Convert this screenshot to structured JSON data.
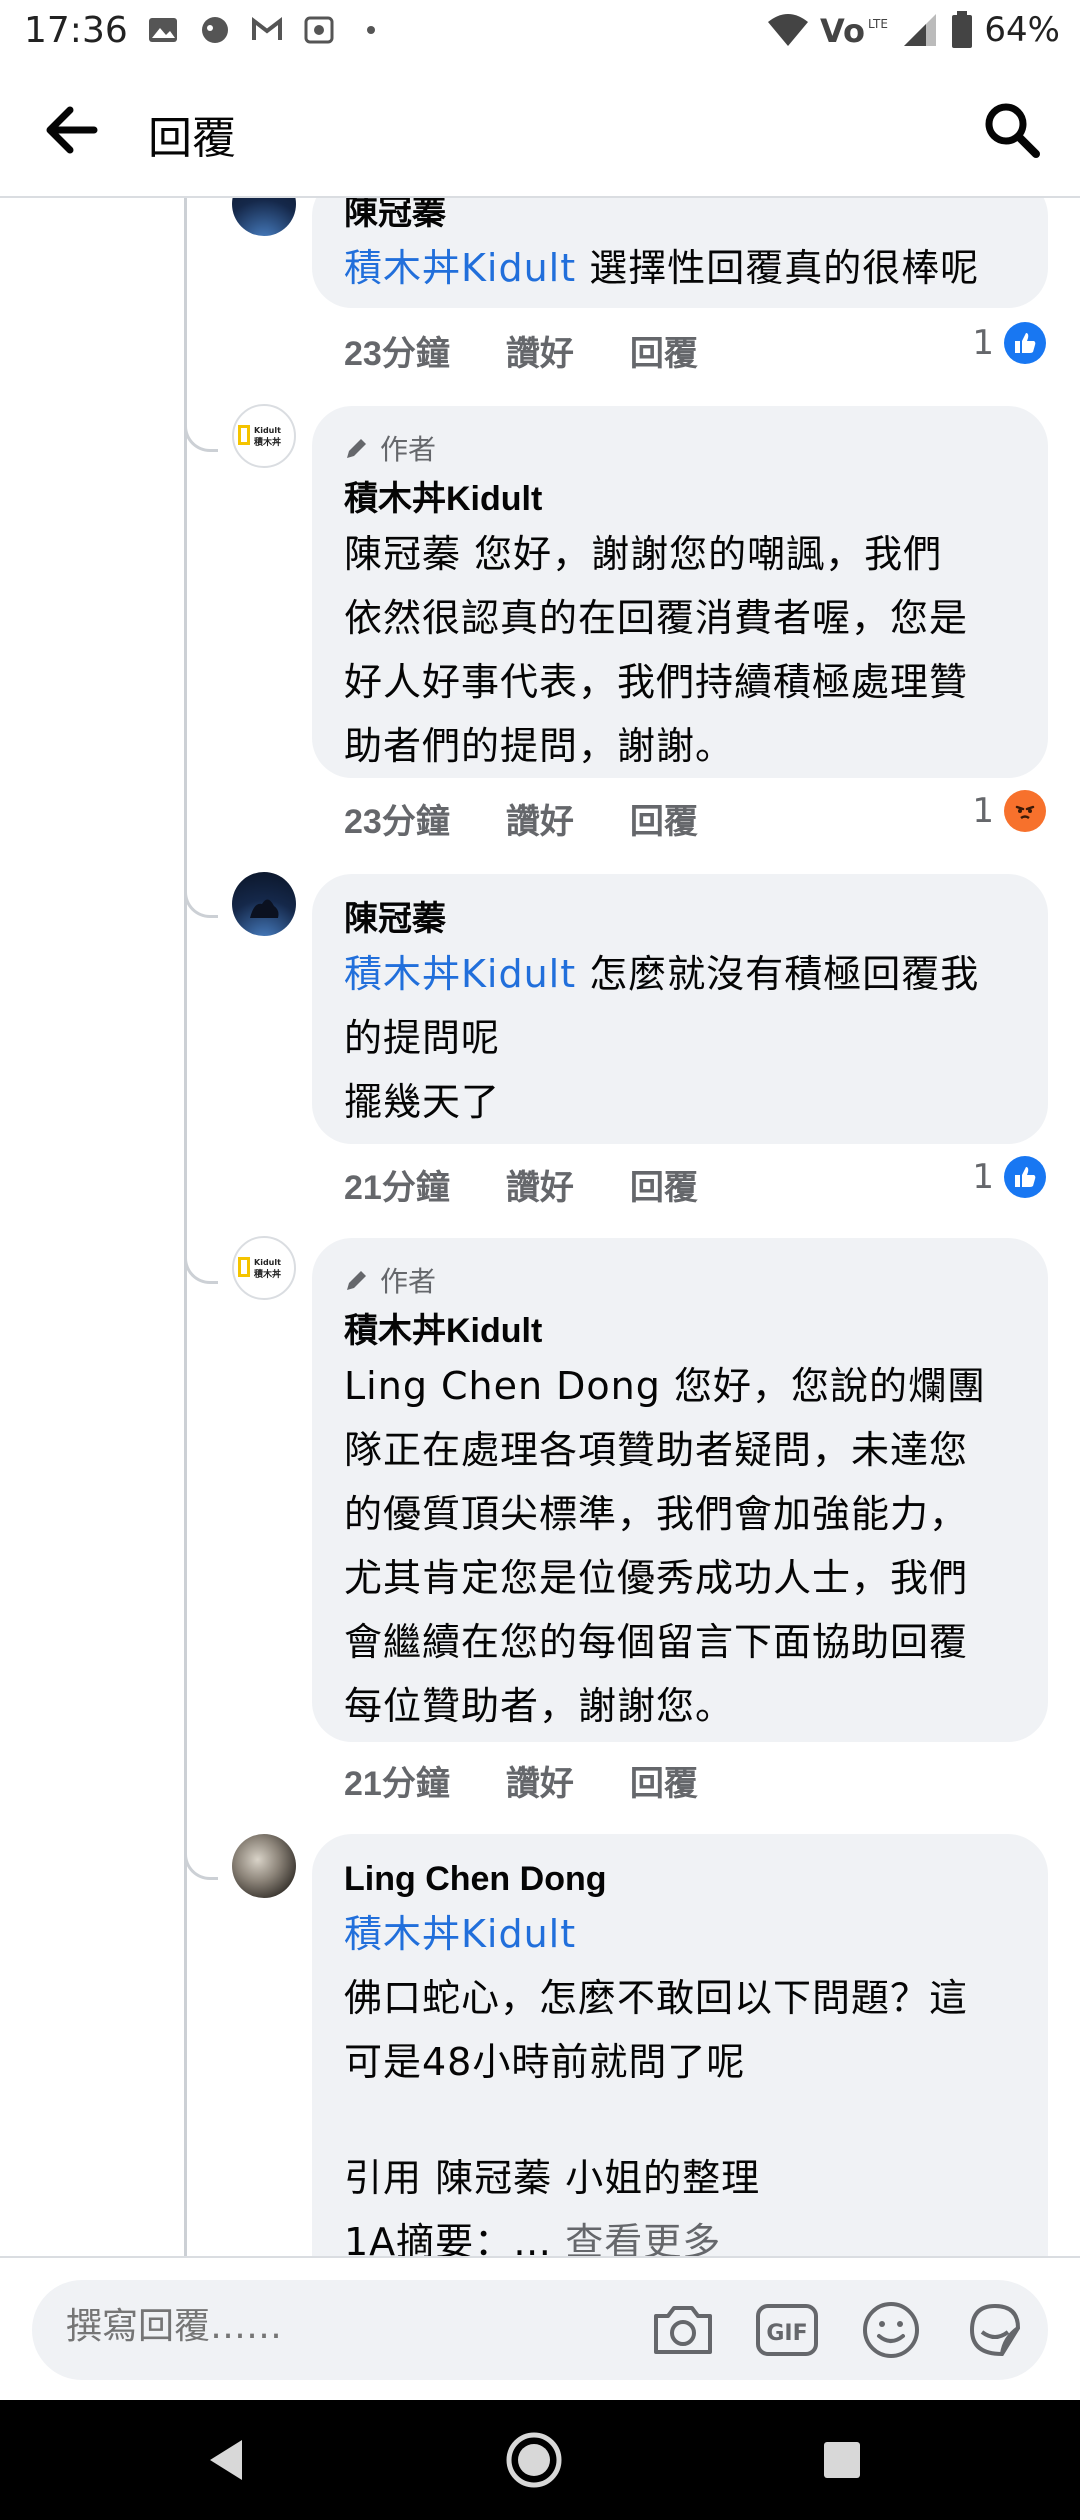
{
  "status_bar": {
    "time": "17:36",
    "battery": "64%",
    "icons_left": [
      "gallery-icon",
      "messenger-bot-icon",
      "gmail-icon",
      "photo-app-icon",
      "dot-icon"
    ],
    "icons_right": [
      "wifi-icon",
      "volte-icon",
      "signal-icon",
      "battery-icon"
    ]
  },
  "header": {
    "title": "回覆",
    "back_icon": "back-arrow-icon",
    "search_icon": "search-icon"
  },
  "comments": [
    {
      "author": "陳冠蓁",
      "mention": "積木丼Kidult",
      "lines": [
        " 選擇性回覆真的很棒呢"
      ],
      "time": "23分鐘",
      "like_label": "讚好",
      "reply_label": "回覆",
      "reaction": {
        "type": "like",
        "count": "1"
      }
    },
    {
      "author_badge": "作者",
      "author": "積木丼Kidult",
      "lines": [
        "陳冠蓁 您好，謝謝您的嘲諷，我們",
        "依然很認真的在回覆消費者喔，您是",
        "好人好事代表，我們持續積極處理贊",
        "助者們的提問，謝謝。"
      ],
      "time": "23分鐘",
      "like_label": "讚好",
      "reply_label": "回覆",
      "reaction": {
        "type": "angry",
        "count": "1"
      }
    },
    {
      "author": "陳冠蓁",
      "mention": "積木丼Kidult",
      "lines": [
        " 怎麼就沒有積極回覆我",
        "的提問呢",
        "擺幾天了"
      ],
      "time": "21分鐘",
      "like_label": "讚好",
      "reply_label": "回覆",
      "reaction": {
        "type": "like",
        "count": "1"
      }
    },
    {
      "author_badge": "作者",
      "author": "積木丼Kidult",
      "lines": [
        "Ling Chen Dong 您好，您說的爛團",
        "隊正在處理各項贊助者疑問，未達您",
        "的優質頂尖標準，我們會加強能力，",
        "尤其肯定您是位優秀成功人士，我們",
        "會繼續在您的每個留言下面協助回覆",
        "每位贊助者，謝謝您。"
      ],
      "time": "21分鐘",
      "like_label": "讚好",
      "reply_label": "回覆"
    },
    {
      "author": "Ling Chen Dong",
      "mention": "積木丼Kidult",
      "lines": [
        "佛口蛇心，怎麼不敢回以下問題？這",
        "可是48小時前就問了呢",
        "",
        "引用 陳冠蓁 小姐的整理",
        "1A摘要：… "
      ],
      "see_more": "查看更多"
    }
  ],
  "avatar_logo_text": {
    "top": "Kidult",
    "bottom": "積木丼"
  },
  "composer": {
    "placeholder": "撰寫回覆……",
    "gif_label": "GIF",
    "icons": [
      "camera-icon",
      "gif-icon",
      "emoji-icon",
      "sticker-icon"
    ]
  },
  "nav": {
    "icons": [
      "nav-back-icon",
      "nav-home-icon",
      "nav-recents-icon"
    ]
  },
  "colors": {
    "mention": "#216fdb",
    "bubble": "#f0f2f5",
    "secondary_text": "#65676b",
    "like_blue": "#1877f2",
    "angry_orange": "#f7712c"
  }
}
